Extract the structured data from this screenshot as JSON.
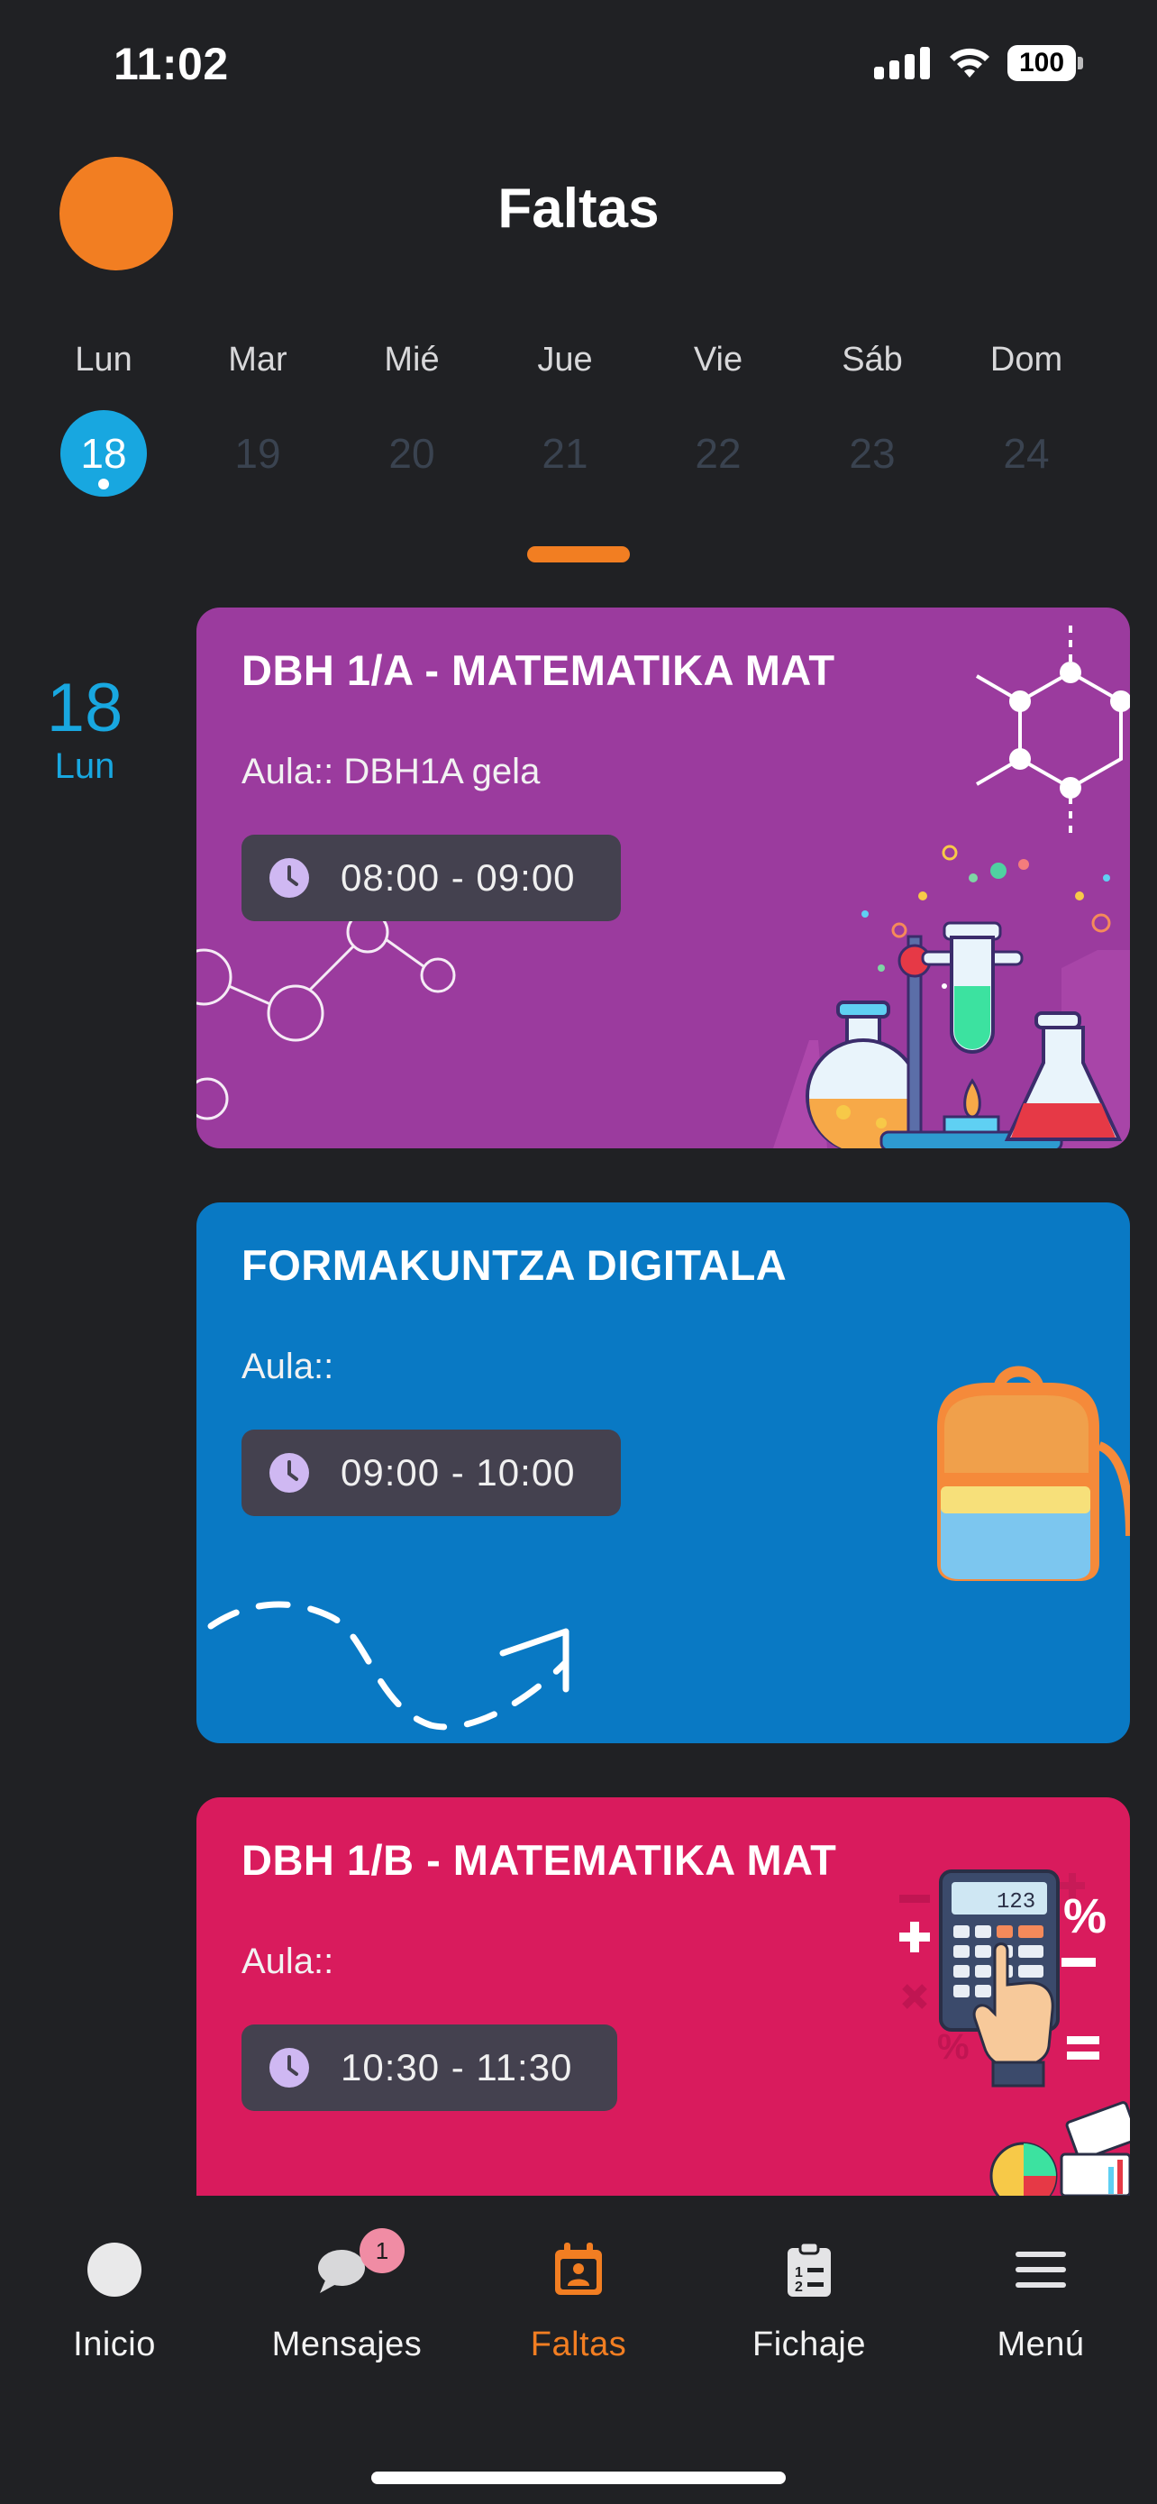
{
  "status_bar": {
    "time": "11:02",
    "battery": "100"
  },
  "header": {
    "title": "Faltas"
  },
  "week": {
    "days": [
      {
        "name": "Lun",
        "num": "18"
      },
      {
        "name": "Mar",
        "num": "19"
      },
      {
        "name": "Mié",
        "num": "20"
      },
      {
        "name": "Jue",
        "num": "21"
      },
      {
        "name": "Vie",
        "num": "22"
      },
      {
        "name": "Sáb",
        "num": "23"
      },
      {
        "name": "Dom",
        "num": "24"
      }
    ],
    "selected_index": 0
  },
  "side_date": {
    "num": "18",
    "day": "Lun"
  },
  "cards": [
    {
      "title": "DBH 1/A - MATEMATIKA MAT",
      "room": "Aula:: DBH1A gela",
      "time": "08:00 - 09:00",
      "color": "#9B3B9E",
      "icon": "chemistry-illustration"
    },
    {
      "title": "FORMAKUNTZA DIGITALA",
      "room": "Aula::",
      "time": "09:00 - 10:00",
      "color": "#0979C4",
      "icon": "backpack-illustration"
    },
    {
      "title": "DBH 1/B - MATEMATIKA MAT",
      "room": "Aula::",
      "time": "10:30 - 11:30",
      "color": "#D91B5D",
      "icon": "calculator-illustration"
    }
  ],
  "nav": {
    "items": [
      {
        "label": "Inicio",
        "icon": "home-circle-icon"
      },
      {
        "label": "Mensajes",
        "icon": "chat-bubbles-icon",
        "badge": "1"
      },
      {
        "label": "Faltas",
        "icon": "calendar-person-icon",
        "active": true
      },
      {
        "label": "Fichaje",
        "icon": "clipboard-list-icon"
      },
      {
        "label": "Menú",
        "icon": "hamburger-menu-icon"
      }
    ]
  },
  "colors": {
    "accent": "#F27E22",
    "selected_day": "#18A7E0",
    "background": "#202124"
  }
}
